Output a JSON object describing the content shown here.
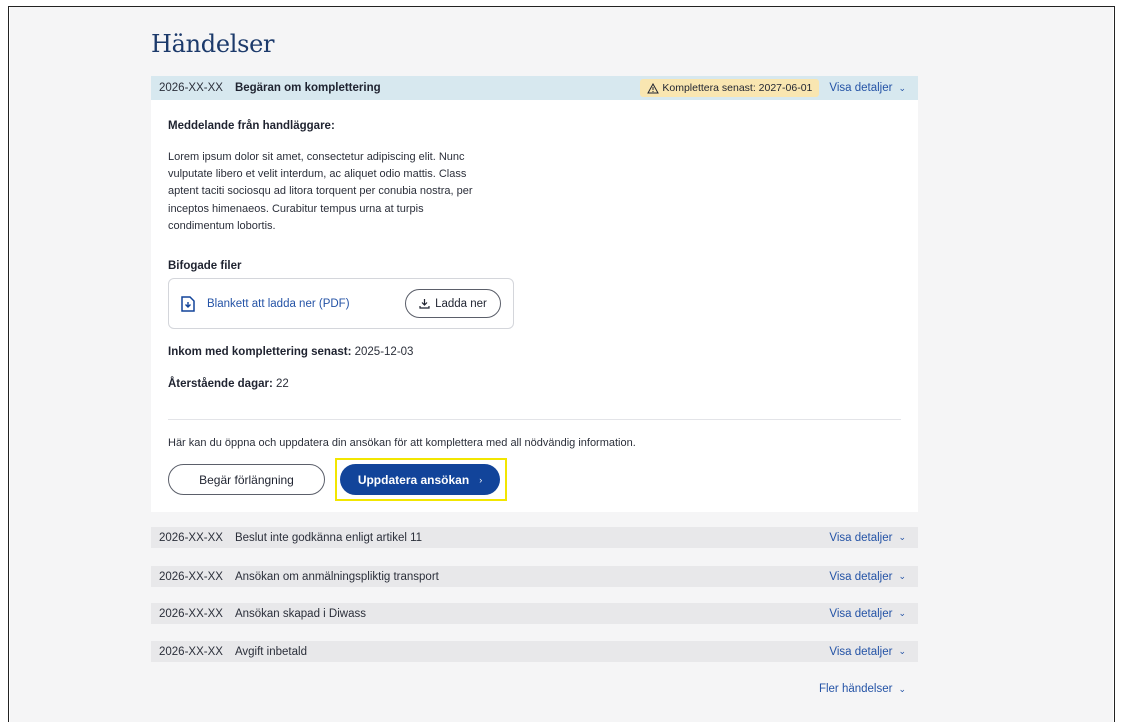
{
  "heading": "Händelser",
  "active_event": {
    "date": "2026-XX-XX",
    "title": "Begäran om komplettering",
    "deadline_badge": "Komplettera senast: 2027-06-01",
    "details_label": "Visa detaljer",
    "message_label": "Meddelande från handläggare:",
    "message_lines": [
      "Lorem ipsum dolor sit amet, consectetur adipiscing elit. Nunc",
      "vulputate libero et velit interdum, ac aliquet odio mattis. Class",
      "aptent taciti sociosqu ad litora torquent per conubia nostra, per",
      "inceptos himenaeos. Curabitur tempus urna at turpis",
      "condimentum lobortis."
    ],
    "files_label": "Bifogade filer",
    "file_name": "Blankett att ladda ner (PDF)",
    "download_label": "Ladda ner",
    "deadline_label": "Inkom med komplettering senast:",
    "deadline_value": "2025-12-03",
    "remaining_label": "Återstående dagar:",
    "remaining_value": "22",
    "info_text": "Här kan du öppna och uppdatera din ansökan för att komplettera med all nödvändig information.",
    "extension_button": "Begär förlängning",
    "update_button": "Uppdatera ansökan"
  },
  "events": [
    {
      "date": "2026-XX-XX",
      "title": "Beslut inte godkänna enligt artikel 11",
      "details_label": "Visa detaljer"
    },
    {
      "date": "2026-XX-XX",
      "title": "Ansökan om anmälningspliktig transport",
      "details_label": "Visa detaljer"
    },
    {
      "date": "2026-XX-XX",
      "title": "Ansökan skapad i Diwass",
      "details_label": "Visa detaljer"
    },
    {
      "date": "2026-XX-XX",
      "title": "Avgift inbetald",
      "details_label": "Visa detaljer"
    }
  ],
  "more_label": "Fler händelser",
  "colors": {
    "accent": "#12449a",
    "link": "#2453a6",
    "header_bg": "#d7e8ef",
    "warning_bg": "#f9e6b1",
    "row_bg": "#e8e8ea",
    "highlight": "#f2e600"
  }
}
